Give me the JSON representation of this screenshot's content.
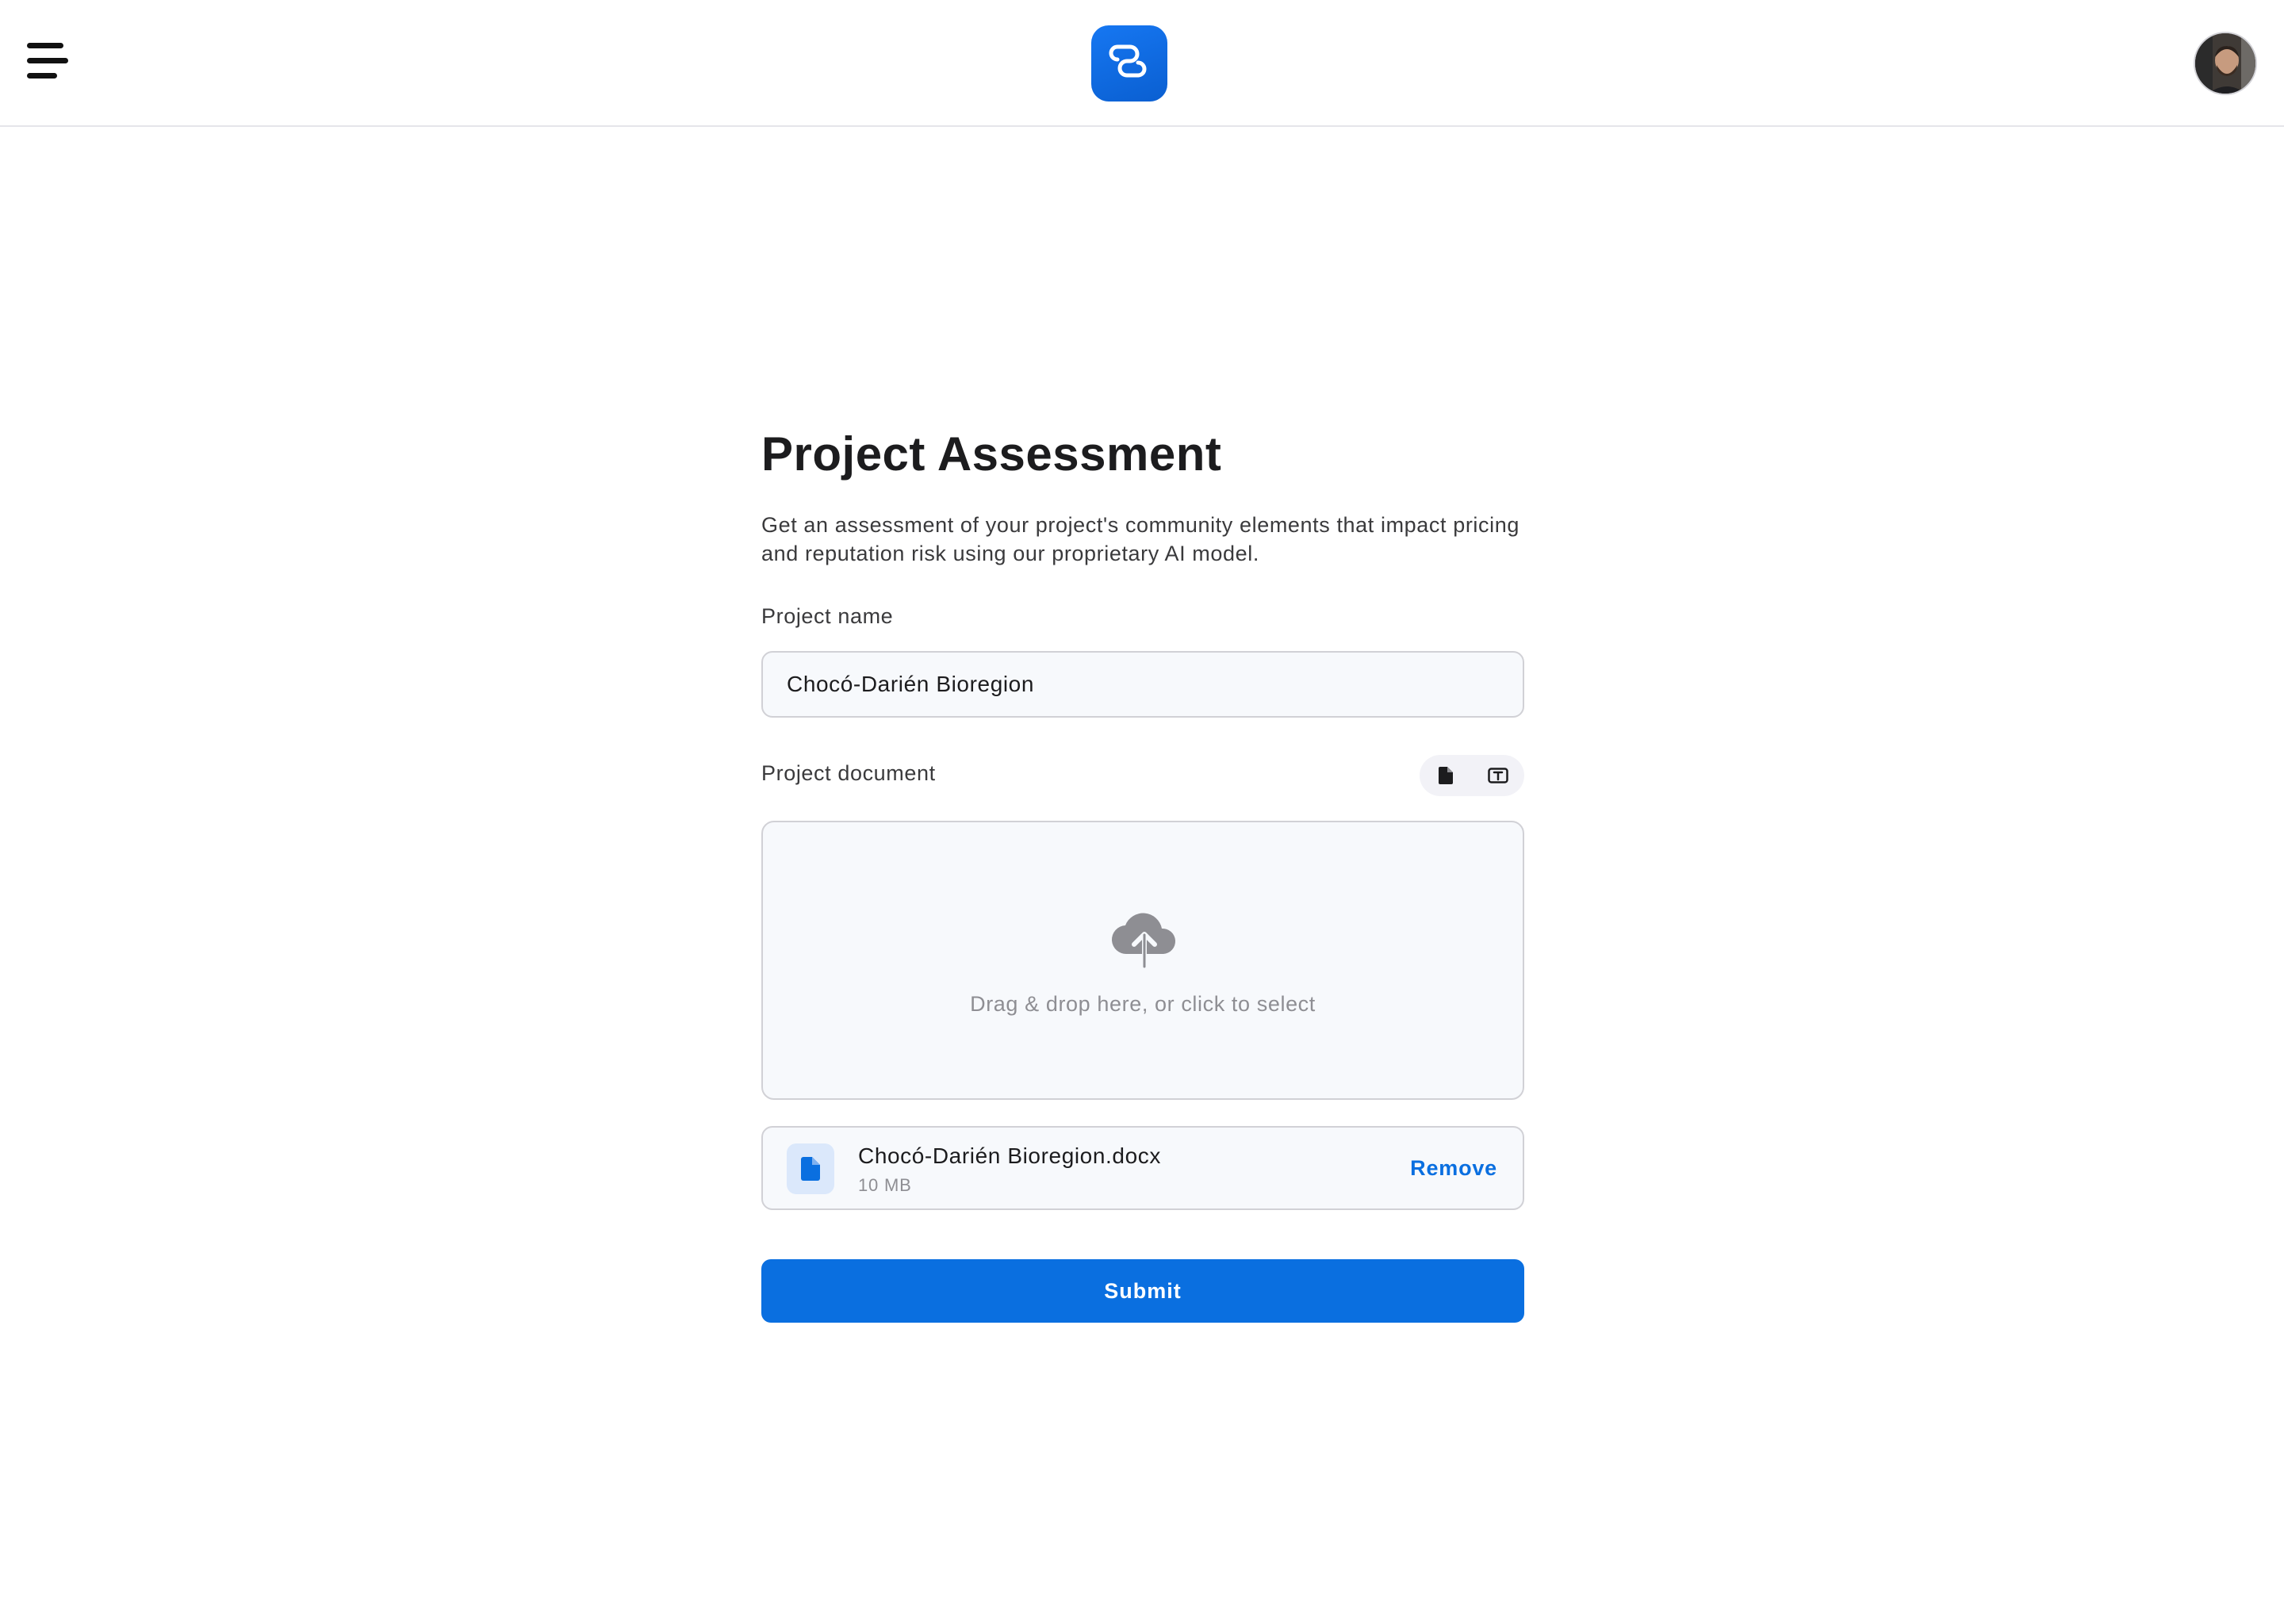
{
  "header": {
    "menu_icon": "hamburger-menu-icon",
    "logo_icon": "app-logo-icon",
    "avatar_icon": "user-avatar",
    "brand_color": "#0a6fe0"
  },
  "form": {
    "title": "Project Assessment",
    "description": "Get an assessment of your project's community elements that impact pricing and reputation risk using our proprietary AI model.",
    "project_name_label": "Project name",
    "project_name_value": "Chocó-Darién Bioregion",
    "project_document_label": "Project document",
    "doc_mode_options": [
      {
        "icon": "file-icon",
        "selected": true
      },
      {
        "icon": "text-box-icon",
        "selected": false
      }
    ],
    "dropzone": {
      "icon": "cloud-upload-icon",
      "text": "Drag & drop here, or click to select"
    },
    "uploaded_file": {
      "icon": "document-icon",
      "name": "Chocó-Darién Bioregion.docx",
      "size": "10 MB",
      "remove_label": "Remove"
    },
    "submit_label": "Submit"
  }
}
